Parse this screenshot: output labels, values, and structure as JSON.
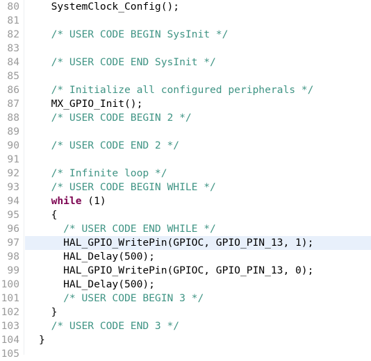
{
  "editor": {
    "language": "c",
    "gutter_text_color": "#9a9a9a",
    "background_color": "#ffffff",
    "highlight_color": "#e8f0fb",
    "comment_color": "#3f9484",
    "keyword_color": "#7d0552",
    "code_color": "#000000",
    "first_line_number": 80,
    "last_line_number": 105,
    "highlighted_line_number": 97
  },
  "lines": [
    {
      "number": "80",
      "highlighted": false,
      "tokens": [
        {
          "type": "plain",
          "text": "  SystemClock_Config();"
        }
      ]
    },
    {
      "number": "81",
      "highlighted": false,
      "tokens": [
        {
          "type": "plain",
          "text": ""
        }
      ]
    },
    {
      "number": "82",
      "highlighted": false,
      "tokens": [
        {
          "type": "comment",
          "text": "  /* USER CODE BEGIN SysInit */"
        }
      ]
    },
    {
      "number": "83",
      "highlighted": false,
      "tokens": [
        {
          "type": "plain",
          "text": ""
        }
      ]
    },
    {
      "number": "84",
      "highlighted": false,
      "tokens": [
        {
          "type": "comment",
          "text": "  /* USER CODE END SysInit */"
        }
      ]
    },
    {
      "number": "85",
      "highlighted": false,
      "tokens": [
        {
          "type": "plain",
          "text": ""
        }
      ]
    },
    {
      "number": "86",
      "highlighted": false,
      "tokens": [
        {
          "type": "comment",
          "text": "  /* Initialize all configured peripherals */"
        }
      ]
    },
    {
      "number": "87",
      "highlighted": false,
      "tokens": [
        {
          "type": "plain",
          "text": "  MX_GPIO_Init();"
        }
      ]
    },
    {
      "number": "88",
      "highlighted": false,
      "tokens": [
        {
          "type": "comment",
          "text": "  /* USER CODE BEGIN 2 */"
        }
      ]
    },
    {
      "number": "89",
      "highlighted": false,
      "tokens": [
        {
          "type": "plain",
          "text": ""
        }
      ]
    },
    {
      "number": "90",
      "highlighted": false,
      "tokens": [
        {
          "type": "comment",
          "text": "  /* USER CODE END 2 */"
        }
      ]
    },
    {
      "number": "91",
      "highlighted": false,
      "tokens": [
        {
          "type": "plain",
          "text": ""
        }
      ]
    },
    {
      "number": "92",
      "highlighted": false,
      "tokens": [
        {
          "type": "comment",
          "text": "  /* Infinite loop */"
        }
      ]
    },
    {
      "number": "93",
      "highlighted": false,
      "tokens": [
        {
          "type": "comment",
          "text": "  /* USER CODE BEGIN WHILE */"
        }
      ]
    },
    {
      "number": "94",
      "highlighted": false,
      "tokens": [
        {
          "type": "plain",
          "text": "  "
        },
        {
          "type": "keyword",
          "text": "while"
        },
        {
          "type": "plain",
          "text": " (1)"
        }
      ]
    },
    {
      "number": "95",
      "highlighted": false,
      "tokens": [
        {
          "type": "plain",
          "text": "  {"
        }
      ]
    },
    {
      "number": "96",
      "highlighted": false,
      "tokens": [
        {
          "type": "comment",
          "text": "    /* USER CODE END WHILE */"
        }
      ]
    },
    {
      "number": "97",
      "highlighted": true,
      "tokens": [
        {
          "type": "plain",
          "text": "    HAL_GPIO_WritePin(GPIOC, GPIO_PIN_13, 1);"
        }
      ]
    },
    {
      "number": "98",
      "highlighted": false,
      "tokens": [
        {
          "type": "plain",
          "text": "    HAL_Delay(500);"
        }
      ]
    },
    {
      "number": "99",
      "highlighted": false,
      "tokens": [
        {
          "type": "plain",
          "text": "    HAL_GPIO_WritePin(GPIOC, GPIO_PIN_13, 0);"
        }
      ]
    },
    {
      "number": "100",
      "highlighted": false,
      "tokens": [
        {
          "type": "plain",
          "text": "    HAL_Delay(500);"
        }
      ]
    },
    {
      "number": "101",
      "highlighted": false,
      "tokens": [
        {
          "type": "comment",
          "text": "    /* USER CODE BEGIN 3 */"
        }
      ]
    },
    {
      "number": "102",
      "highlighted": false,
      "tokens": [
        {
          "type": "plain",
          "text": "  }"
        }
      ]
    },
    {
      "number": "103",
      "highlighted": false,
      "tokens": [
        {
          "type": "comment",
          "text": "  /* USER CODE END 3 */"
        }
      ]
    },
    {
      "number": "104",
      "highlighted": false,
      "tokens": [
        {
          "type": "plain",
          "text": "}"
        }
      ]
    },
    {
      "number": "105",
      "highlighted": false,
      "tokens": [
        {
          "type": "plain",
          "text": ""
        }
      ]
    }
  ]
}
